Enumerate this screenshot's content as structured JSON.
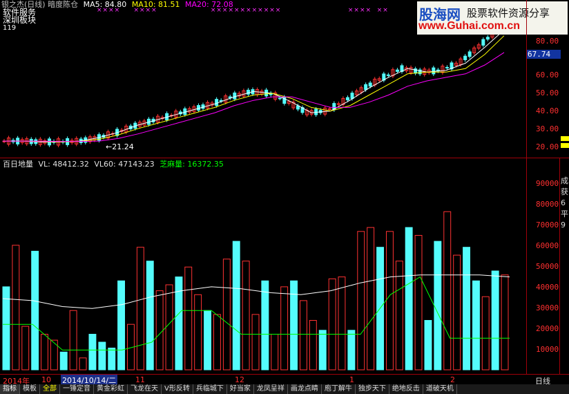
{
  "header": {
    "title": "银之杰(日线)",
    "indicator_name": "暗度陈仓",
    "ma5": "MA5: 84.80",
    "ma10": "MA10: 81.51",
    "ma20": "MA20: 72.08",
    "watermark_lines": [
      "软件服务",
      "深圳板块",
      "119"
    ],
    "colors": {
      "ma5": "#ffffff",
      "ma10": "#ffff00",
      "ma20": "#ff00ff"
    }
  },
  "logo": {
    "brand": "股海网",
    "slogan": "股票软件资源分享",
    "url": "www.Guhai.com.cn"
  },
  "price_pane": {
    "low_marker": "←21.24",
    "current_price": "67.74",
    "y_ticks": [
      "80.00",
      "70.00",
      "60.00",
      "50.00",
      "40.00",
      "30.00",
      "20.00"
    ]
  },
  "volume_pane": {
    "title": "百日地量",
    "vl": "VL: 48412.32",
    "vl60": "VL60: 47143.23",
    "sesame": "芝麻量: 16372.35",
    "y_ticks": [
      "90000",
      "80000",
      "70000",
      "60000",
      "50000",
      "40000",
      "30000",
      "20000",
      "10000"
    ]
  },
  "right_panel": {
    "labels": [
      "成",
      "获",
      "6",
      "平",
      "9"
    ]
  },
  "time_axis": {
    "labels": [
      "2014年",
      "10",
      "2014/10/14/二",
      "11",
      "12",
      "1",
      "2"
    ],
    "period": "日线"
  },
  "tabs": [
    "指标",
    "模板",
    "全部",
    "一锤定音",
    "黄金彩虹",
    "飞龙在天",
    "V形反转",
    "兵临城下",
    "好当家",
    "龙凤呈祥",
    "画龙点睛",
    "庖丁解牛",
    "独步天下",
    "绝地反击",
    "道破天机"
  ],
  "chart_data": [
    {
      "type": "line",
      "title": "银之杰(日线) 暗度陈仓",
      "ylim": [
        15,
        90
      ],
      "series": [
        {
          "name": "MA5",
          "values": [
            22,
            22,
            21.5,
            21.5,
            22,
            24,
            27,
            31,
            34,
            37,
            40,
            43,
            47,
            50,
            49,
            44,
            38,
            39,
            45,
            52,
            58,
            63,
            61,
            62,
            66,
            75,
            84.8
          ]
        },
        {
          "name": "MA10",
          "values": [
            22,
            22,
            21.8,
            21.6,
            21.8,
            23,
            25.5,
            29,
            32,
            35,
            38,
            41,
            45,
            48,
            49,
            46,
            41,
            39,
            42,
            48,
            54,
            60,
            61,
            61,
            63,
            71,
            81.51
          ]
        },
        {
          "name": "MA20",
          "values": [
            22,
            22,
            21.9,
            21.8,
            21.8,
            22,
            23.5,
            26,
            29,
            32,
            35,
            38,
            42,
            45,
            47,
            47,
            44,
            41,
            41,
            44,
            48,
            53,
            56,
            58,
            60,
            65,
            72.08
          ]
        }
      ]
    },
    {
      "type": "bar",
      "title": "百日地量",
      "ylim": [
        0,
        100000
      ],
      "values": [
        42000,
        63000,
        22000,
        60000,
        18000,
        15000,
        9000,
        30000,
        6000,
        18000,
        14000,
        11000,
        45000,
        23000,
        62000,
        55000,
        40000,
        43000,
        47000,
        52000,
        38000,
        30000,
        28000,
        56000,
        65000,
        55000,
        28000,
        45000,
        18000,
        42000,
        45000,
        35000,
        25000,
        20000,
        46000,
        47000,
        20000,
        70000,
        72000,
        62000,
        70000,
        55000,
        72000,
        68000,
        25000,
        65000,
        80000,
        58000,
        62000,
        45000,
        37000,
        50000,
        48000
      ],
      "series": [
        {
          "name": "VL60",
          "values": [
            36000,
            35000,
            32000,
            31000,
            33000,
            37000,
            40000,
            42000,
            41000,
            39000,
            38000,
            40000,
            44000,
            47000,
            48000,
            48000,
            48000,
            47000
          ]
        },
        {
          "name": "芝麻量",
          "values": [
            23000,
            23000,
            10000,
            10000,
            10000,
            14000,
            30000,
            30000,
            18000,
            18000,
            18000,
            18000,
            18000,
            38000,
            47000,
            16000,
            16000,
            16000
          ]
        }
      ]
    }
  ]
}
